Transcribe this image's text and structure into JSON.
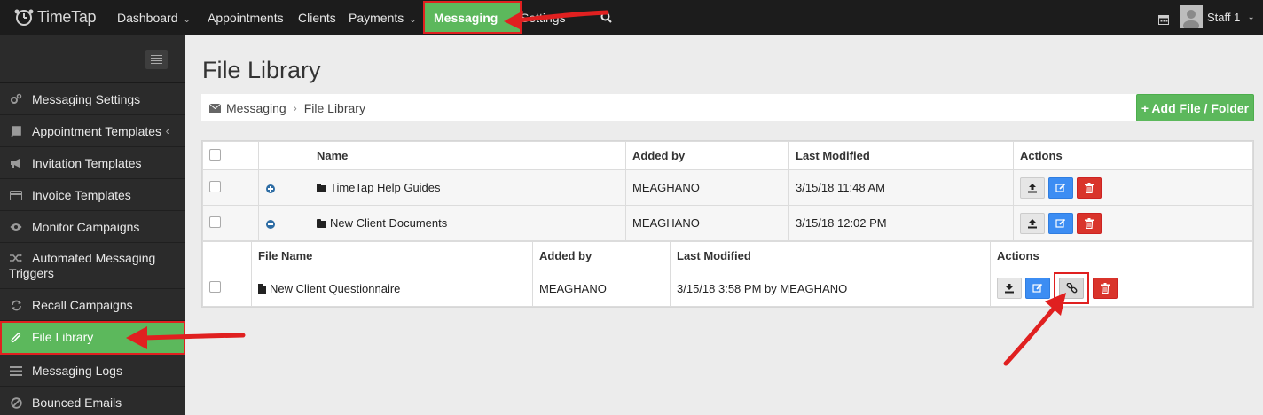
{
  "brand": {
    "name": "TimeTap"
  },
  "nav": {
    "items": [
      {
        "label": "Dashboard",
        "has_caret": true
      },
      {
        "label": "Appointments",
        "has_caret": false
      },
      {
        "label": "Clients",
        "has_caret": false
      },
      {
        "label": "Payments",
        "has_caret": true
      },
      {
        "label": "Messaging",
        "has_caret": true,
        "active": true
      },
      {
        "label": "Settings",
        "has_caret": false
      }
    ],
    "search_icon": "search-icon",
    "calendar_icon": "calendar-icon",
    "user": {
      "name": "Staff 1"
    }
  },
  "sidebar": {
    "items": [
      {
        "label": "Messaging Settings",
        "icon": "gears-icon"
      },
      {
        "label": "Appointment Templates",
        "icon": "book-icon",
        "chevron": "‹"
      },
      {
        "label": "Invitation Templates",
        "icon": "bullhorn-icon"
      },
      {
        "label": "Invoice Templates",
        "icon": "credit-card-icon"
      },
      {
        "label": "Monitor Campaigns",
        "icon": "eye-icon"
      },
      {
        "label": "Automated Messaging Triggers",
        "line1": "Automated Messaging",
        "line2": "Triggers",
        "icon": "shuffle-icon"
      },
      {
        "label": "Recall Campaigns",
        "icon": "refresh-icon"
      },
      {
        "label": "File Library",
        "icon": "paperclip-icon",
        "active": true
      },
      {
        "label": "Messaging Logs",
        "icon": "list-icon"
      },
      {
        "label": "Bounced Emails",
        "icon": "ban-icon"
      }
    ]
  },
  "page": {
    "title": "File Library",
    "breadcrumb": {
      "root": "Messaging",
      "sep": "›",
      "current": "File Library"
    },
    "add_button": "+ Add File / Folder"
  },
  "table": {
    "headers": {
      "name": "Name",
      "added_by": "Added by",
      "last_modified": "Last Modified",
      "actions": "Actions"
    },
    "folders": [
      {
        "name": "TimeTap Help Guides",
        "added_by": "MEAGHANO",
        "last_modified": "3/15/18 11:48 AM",
        "expanded": false
      },
      {
        "name": "New Client Documents",
        "added_by": "MEAGHANO",
        "last_modified": "3/15/18 12:02 PM",
        "expanded": true
      }
    ],
    "sub_headers": {
      "file_name": "File Name",
      "added_by": "Added by",
      "last_modified": "Last Modified",
      "actions": "Actions"
    },
    "files": [
      {
        "name": "New Client Questionnaire",
        "added_by": "MEAGHANO",
        "last_modified": "3/15/18 3:58 PM by MEAGHANO"
      }
    ]
  },
  "colors": {
    "accent_green": "#5cb85c",
    "edit_blue": "#3c8df3",
    "delete_red": "#d9342b",
    "highlight_red": "#e02020",
    "navbar_bg": "#1c1c1c",
    "sidebar_bg": "#2b2b2b"
  }
}
